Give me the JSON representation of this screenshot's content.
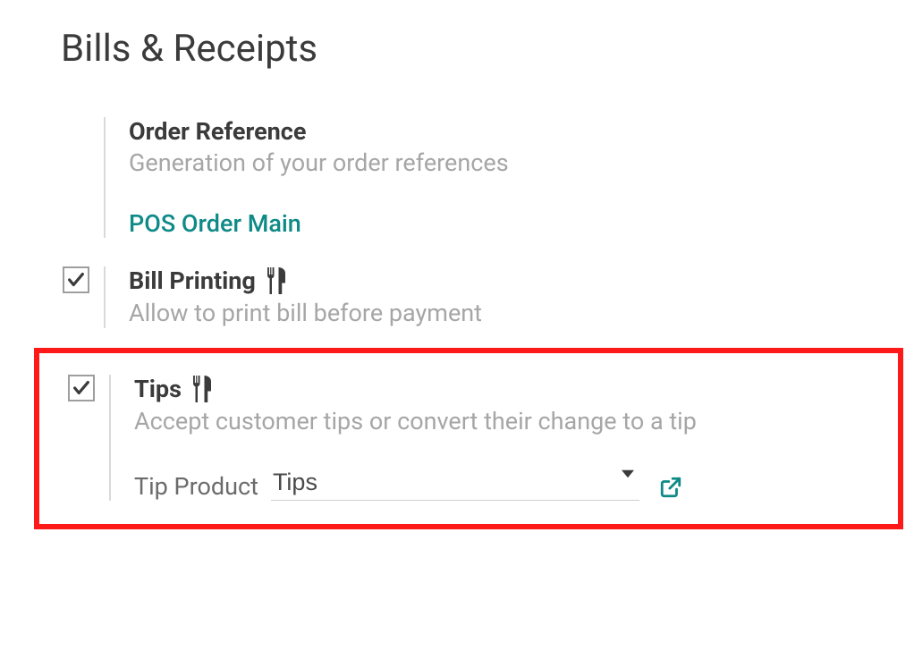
{
  "page": {
    "section_title": "Bills & Receipts"
  },
  "settings": {
    "order_reference": {
      "title": "Order Reference",
      "description": "Generation of your order references",
      "link_label": "POS Order Main"
    },
    "bill_printing": {
      "title": "Bill Printing",
      "description": "Allow to print bill before payment",
      "checked": true
    },
    "tips": {
      "title": "Tips",
      "description": "Accept customer tips or convert their change to a tip",
      "checked": true,
      "tip_product_label": "Tip Product",
      "tip_product_value": "Tips"
    }
  }
}
